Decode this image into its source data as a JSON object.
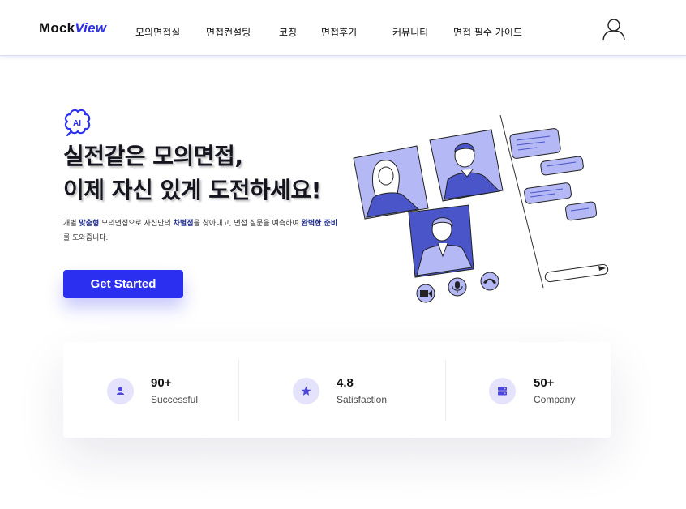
{
  "header": {
    "logo_prefix": "Mock",
    "logo_accent": "View",
    "nav": [
      "모의면접실",
      "면접컨설팅",
      "코칭",
      "면접후기",
      "커뮤니티",
      "면접 필수 가이드"
    ]
  },
  "hero": {
    "badge_text": "AI",
    "headline_line1": "실전같은 모의면접,",
    "headline_line2": "이제 자신 있게 도전하세요!",
    "desc": {
      "t1": "개별 ",
      "b1": "맞춤형",
      "t2": " 모의면접으로 자신만의 ",
      "b2": "차별점",
      "t3": "을 찾아내고, 면접 질문을 예측하여 ",
      "b3": "완벽한 준비",
      "t4": "를 도와줍니다."
    },
    "cta_label": "Get Started"
  },
  "stats": [
    {
      "value": "90+",
      "label": "Successful",
      "icon": "user-icon"
    },
    {
      "value": "4.8",
      "label": "Satisfaction",
      "icon": "star-icon"
    },
    {
      "value": "50+",
      "label": "Company",
      "icon": "server-icon"
    }
  ],
  "colors": {
    "accent": "#2b2ff0",
    "icon_bg": "#e4e3fb",
    "illustration_light": "#b4b8f4",
    "illustration_dark": "#4a55c9"
  }
}
